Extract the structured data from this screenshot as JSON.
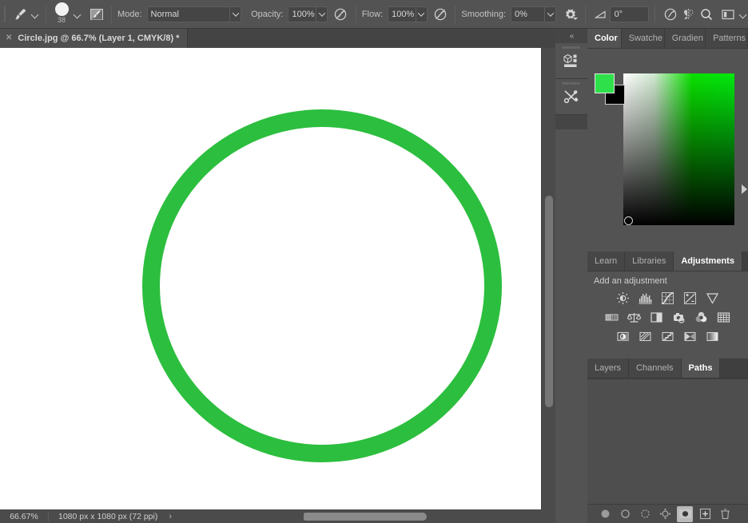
{
  "options_bar": {
    "tool_icon": "brush-tool-icon",
    "brush_preset_chevron": "chevron-down-icon",
    "brush_size": "38",
    "brush_size_chevron": "chevron-down-icon",
    "toggle_brush_panel_icon": "brush-settings-panel-icon",
    "mode_label": "Mode:",
    "mode_value": "Normal",
    "opacity_label": "Opacity:",
    "opacity_value": "100%",
    "opacity_pressure_icon": "pressure-opacity-icon",
    "flow_label": "Flow:",
    "flow_value": "100%",
    "airbrush_icon": "airbrush-icon",
    "smoothing_label": "Smoothing:",
    "smoothing_value": "0%",
    "smoothing_options_icon": "gear-icon",
    "angle_icon": "brush-angle-icon",
    "angle_value": "0°",
    "pressure_size_icon": "pressure-size-icon",
    "symmetry_icon": "symmetry-butterfly-icon",
    "zoom_icon": "search-icon",
    "workspace_icon": "workspace-switcher-icon",
    "workspace_chevron": "chevron-down-icon"
  },
  "document_tab": {
    "close_icon": "close-icon",
    "title": "Circle.jpg @ 66.7% (Layer 1, CMYK/8) *"
  },
  "canvas": {
    "background_color": "#ffffff",
    "shape_name": "green-circle-ring",
    "shape_color": "#2cbe3e",
    "stroke_width_px": "22"
  },
  "scrollbars": {
    "vertical_name": "canvas-vertical-scrollbar",
    "horizontal_name": "canvas-horizontal-scrollbar"
  },
  "status_bar": {
    "zoom": "66.67%",
    "document_info": "1080 px x 1080 px (72 ppi)",
    "expand_arrow": "›"
  },
  "dock_strip": {
    "collapse_icon": "collapse-panels-icon",
    "items": [
      {
        "name": "3d-panel-icon",
        "label": "3D"
      },
      {
        "name": "tool-presets-panel-icon",
        "label": "Tool Presets"
      }
    ]
  },
  "color_group": {
    "tabs": [
      {
        "label": "Color",
        "active": true
      },
      {
        "label": "Swatche",
        "active": false
      },
      {
        "label": "Gradien",
        "active": false
      },
      {
        "label": "Patterns",
        "active": false
      }
    ],
    "foreground_color": "#2ee04a",
    "background_color": "#000000",
    "field_marker": "color-field-marker",
    "flyout_arrow": "panel-flyout-arrow"
  },
  "adjustments_group": {
    "tabs": [
      {
        "label": "Learn",
        "active": false
      },
      {
        "label": "Libraries",
        "active": false
      },
      {
        "label": "Adjustments",
        "active": true
      }
    ],
    "heading": "Add an adjustment",
    "rows": [
      [
        {
          "name": "brightness-contrast-icon",
          "label": "Brightness/Contrast"
        },
        {
          "name": "levels-icon",
          "label": "Levels"
        },
        {
          "name": "curves-icon",
          "label": "Curves"
        },
        {
          "name": "exposure-icon",
          "label": "Exposure"
        },
        {
          "name": "vibrance-icon",
          "label": "Vibrance"
        }
      ],
      [
        {
          "name": "hue-saturation-icon",
          "label": "Hue/Saturation"
        },
        {
          "name": "color-balance-icon",
          "label": "Color Balance"
        },
        {
          "name": "black-and-white-icon",
          "label": "Black & White"
        },
        {
          "name": "photo-filter-icon",
          "label": "Photo Filter"
        },
        {
          "name": "channel-mixer-icon",
          "label": "Channel Mixer"
        },
        {
          "name": "color-lookup-icon",
          "label": "Color Lookup"
        }
      ],
      [
        {
          "name": "invert-icon",
          "label": "Invert"
        },
        {
          "name": "posterize-icon",
          "label": "Posterize"
        },
        {
          "name": "threshold-icon",
          "label": "Threshold"
        },
        {
          "name": "selective-color-icon",
          "label": "Selective Color"
        },
        {
          "name": "gradient-map-icon",
          "label": "Gradient Map"
        }
      ]
    ]
  },
  "layers_group": {
    "tabs": [
      {
        "label": "Layers",
        "active": false
      },
      {
        "label": "Channels",
        "active": false
      },
      {
        "label": "Paths",
        "active": true
      }
    ],
    "footer_buttons": [
      {
        "name": "fill-path-with-foreground-button",
        "label": "Fill path with foreground color"
      },
      {
        "name": "stroke-path-with-brush-button",
        "label": "Stroke path with brush"
      },
      {
        "name": "load-path-as-selection-button",
        "label": "Load path as a selection"
      },
      {
        "name": "make-work-path-button",
        "label": "Make work path from selection"
      },
      {
        "name": "add-layer-mask-button",
        "label": "Add a layer mask"
      },
      {
        "name": "new-path-button",
        "label": "Create new path"
      },
      {
        "name": "delete-path-button",
        "label": "Delete current path"
      }
    ]
  }
}
